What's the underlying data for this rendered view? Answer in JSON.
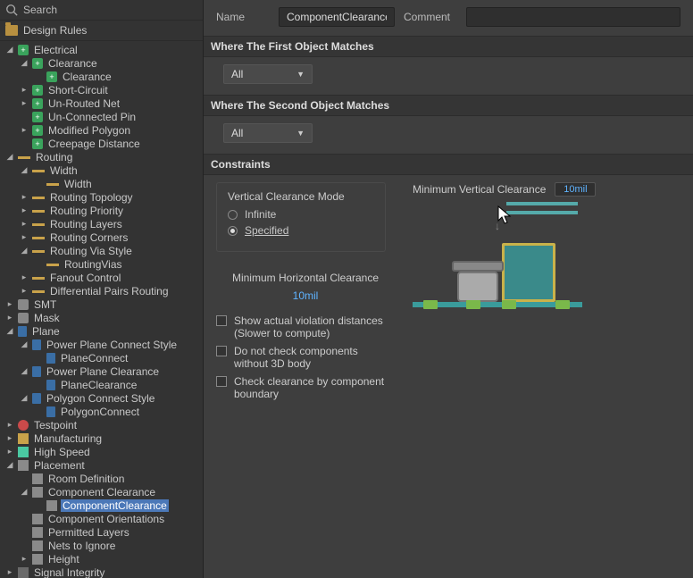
{
  "search": {
    "placeholder": "Search"
  },
  "rules_root": "Design Rules",
  "tree": {
    "electrical": "Electrical",
    "clearance": "Clearance",
    "clearance_rule": "Clearance",
    "short_circuit": "Short-Circuit",
    "unrouted_net": "Un-Routed Net",
    "unconnected_pin": "Un-Connected Pin",
    "modified_polygon": "Modified Polygon",
    "creepage": "Creepage Distance",
    "routing": "Routing",
    "width": "Width",
    "width_rule": "Width",
    "routing_topology": "Routing Topology",
    "routing_priority": "Routing Priority",
    "routing_layers": "Routing Layers",
    "routing_corners": "Routing Corners",
    "routing_via_style": "Routing Via Style",
    "routing_vias": "RoutingVias",
    "fanout": "Fanout Control",
    "diffpairs": "Differential Pairs Routing",
    "smt": "SMT",
    "mask": "Mask",
    "plane": "Plane",
    "pp_connect_style": "Power Plane Connect Style",
    "plane_connect": "PlaneConnect",
    "pp_clearance": "Power Plane Clearance",
    "plane_clearance": "PlaneClearance",
    "poly_connect_style": "Polygon Connect Style",
    "polygon_connect": "PolygonConnect",
    "testpoint": "Testpoint",
    "manufacturing": "Manufacturing",
    "high_speed": "High Speed",
    "placement": "Placement",
    "room_definition": "Room Definition",
    "component_clearance": "Component Clearance",
    "component_clearance_rule": "ComponentClearance",
    "component_orientations": "Component Orientations",
    "permitted_layers": "Permitted Layers",
    "nets_to_ignore": "Nets to Ignore",
    "height": "Height",
    "signal_integrity": "Signal Integrity"
  },
  "form": {
    "name_label": "Name",
    "name_value": "ComponentClearance",
    "comment_label": "Comment",
    "comment_value": "",
    "where_first": "Where The First Object Matches",
    "where_second": "Where The Second Object Matches",
    "scope1": "All",
    "scope2": "All",
    "constraints": "Constraints",
    "vc_mode": "Vertical Clearance Mode",
    "radio_infinite": "Infinite",
    "radio_specified": "Specified",
    "mhc_label": "Minimum Horizontal Clearance",
    "mhc_value": "10mil",
    "mvc_label": "Minimum Vertical Clearance",
    "mvc_value": "10mil",
    "chk1": "Show actual violation distances (Slower to compute)",
    "chk2": "Do not check components without 3D body",
    "chk3": "Check clearance by component boundary"
  }
}
